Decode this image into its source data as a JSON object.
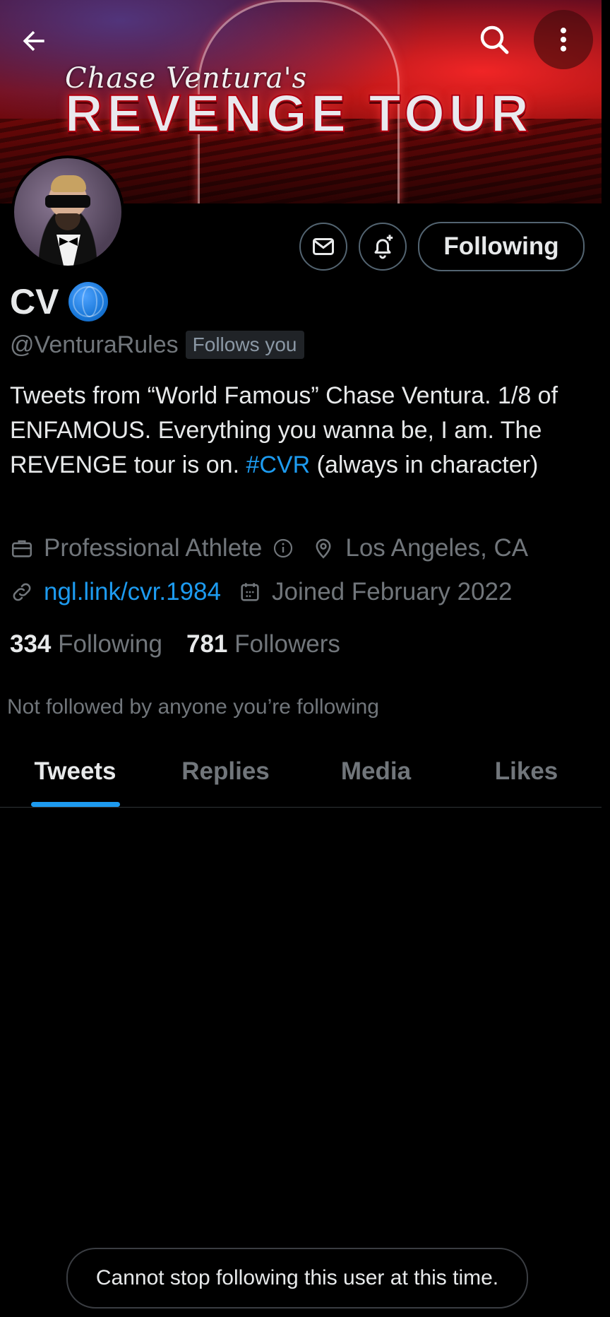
{
  "banner": {
    "script_text": "Chase Ventura's",
    "title_text": "REVENGE TOUR"
  },
  "header": {
    "back_icon": "arrow-left-icon",
    "search_icon": "search-icon",
    "more_icon": "more-vertical-icon"
  },
  "actions": {
    "message_icon": "mail-icon",
    "notify_icon": "bell-plus-icon",
    "following_label": "Following"
  },
  "profile": {
    "display_name": "CV",
    "badge_icon": "globe-icon",
    "handle": "@VenturaRules",
    "follows_you": "Follows you",
    "bio_part1": "Tweets from “World Famous” Chase Ventura. 1/8 of ENFAMOUS. Everything you wanna be, I am. The REVENGE tour is on. ",
    "bio_hashtag": "#CVR",
    "bio_part2": " (always in character)",
    "category": "Professional Athlete",
    "location": "Los Angeles, CA",
    "link": "ngl.link/cvr.1984",
    "joined": "Joined February 2022",
    "following_count": "334",
    "following_label": "Following",
    "followers_count": "781",
    "followers_label": "Followers",
    "not_followed_text": "Not followed by anyone you’re following"
  },
  "tabs": [
    {
      "label": "Tweets",
      "active": true
    },
    {
      "label": "Replies",
      "active": false
    },
    {
      "label": "Media",
      "active": false
    },
    {
      "label": "Likes",
      "active": false
    }
  ],
  "toast": {
    "message": "Cannot stop following this user at this time."
  },
  "colors": {
    "accent": "#1d9bf0",
    "background": "#000000",
    "muted_text": "#71767b",
    "primary_text": "#e7e9ea"
  }
}
